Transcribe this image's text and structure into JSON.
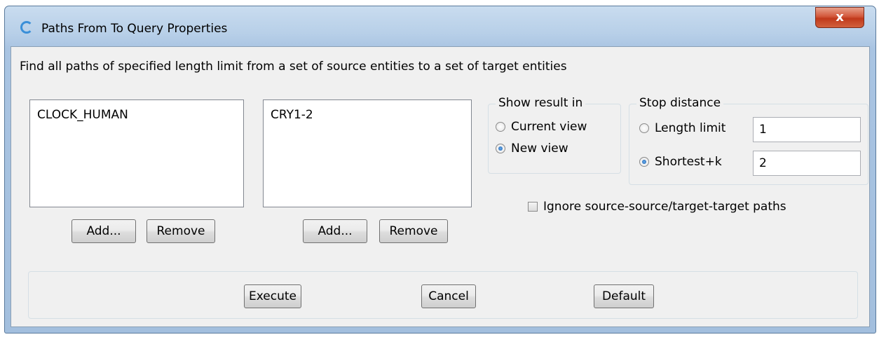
{
  "window": {
    "title": "Paths From To Query Properties",
    "close_label": "x"
  },
  "description": "Find all paths of specified length limit from a set of source entities to a set of target entities",
  "source_list": {
    "items": [
      "CLOCK_HUMAN"
    ],
    "add_label": "Add...",
    "remove_label": "Remove"
  },
  "target_list": {
    "items": [
      "CRY1-2"
    ],
    "add_label": "Add...",
    "remove_label": "Remove"
  },
  "show_result": {
    "label": "Show result in",
    "options": [
      {
        "label": "Current view",
        "checked": false
      },
      {
        "label": "New view",
        "checked": true
      }
    ]
  },
  "stop_distance": {
    "label": "Stop distance",
    "options": [
      {
        "label": "Length limit",
        "value": "1",
        "checked": false
      },
      {
        "label": "Shortest+k",
        "value": "2",
        "checked": true
      }
    ]
  },
  "ignore_checkbox": {
    "label": "Ignore source-source/target-target paths",
    "checked": false
  },
  "footer": {
    "execute_label": "Execute",
    "cancel_label": "Cancel",
    "default_label": "Default"
  }
}
